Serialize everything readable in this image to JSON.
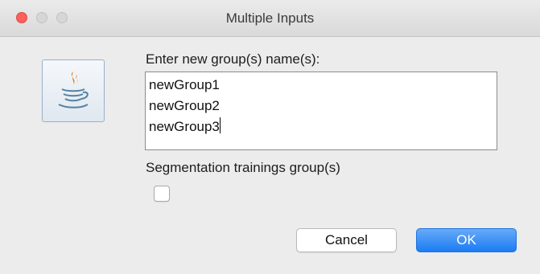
{
  "window": {
    "title": "Multiple Inputs"
  },
  "dialog": {
    "icon": "java-coffee-cup-icon",
    "prompt_label": "Enter new group(s) name(s):",
    "group_names": [
      "newGroup1",
      "newGroup2",
      "newGroup3"
    ],
    "segmentation_label": "Segmentation trainings group(s)",
    "segmentation_checked": false
  },
  "buttons": {
    "cancel_label": "Cancel",
    "ok_label": "OK"
  },
  "colors": {
    "close": "#fc605c",
    "ok_button": "#1b7cf3",
    "background": "#ececec"
  }
}
